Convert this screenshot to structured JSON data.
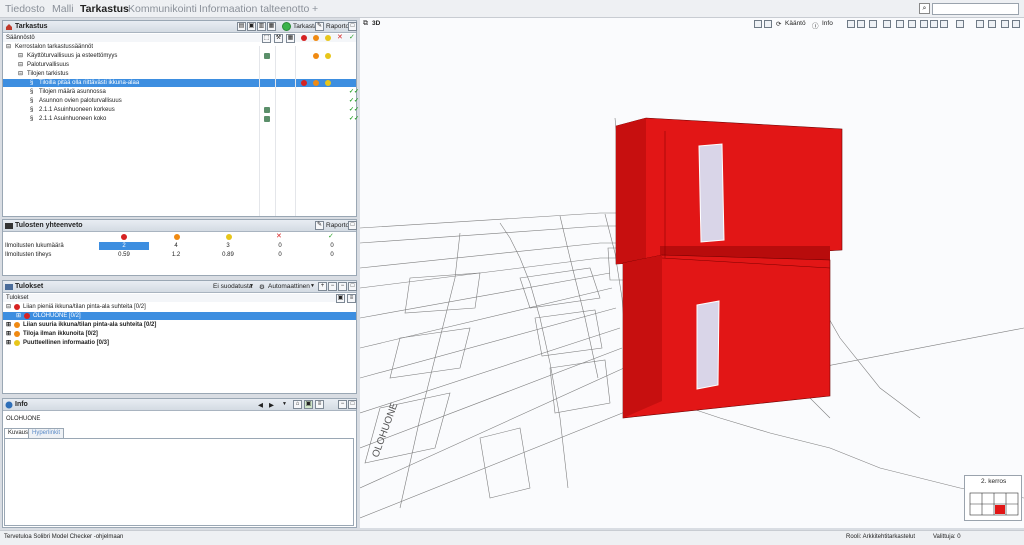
{
  "menu": {
    "items": [
      "Tiedosto",
      "Malli",
      "Tarkastus",
      "Kommunikointi",
      "Informaation talteenotto",
      "+"
    ],
    "active_index": 2
  },
  "tarkastus_panel": {
    "title": "Tarkastus",
    "subheader": "Säännöstö",
    "btn_check": "Tarkasta",
    "btn_report": "Raportoi",
    "tree": [
      {
        "label": "Kerrostalon tarkastussäännöt",
        "level": 0,
        "kind": "ruleset",
        "selected": false
      },
      {
        "label": "Käyttöturvallisuus ja esteettömyys",
        "level": 1,
        "kind": "ruleset",
        "selected": false
      },
      {
        "label": "Paloturvallisuus",
        "level": 1,
        "kind": "ruleset",
        "selected": false
      },
      {
        "label": "Tilojen tarkistus",
        "level": 1,
        "kind": "ruleset",
        "selected": false
      },
      {
        "label": "Tiloilla pitää olla riittävästi ikkuna-alaa",
        "level": 2,
        "kind": "rule",
        "selected": true
      },
      {
        "label": "Tilojen määrä asunnossa",
        "level": 2,
        "kind": "rule",
        "selected": false
      },
      {
        "label": "Asunnon ovien paloturvallisuus",
        "level": 2,
        "kind": "rule",
        "selected": false
      },
      {
        "label": "2.1.1 Asuinhuoneen korkeus",
        "level": 2,
        "kind": "rule",
        "selected": false
      },
      {
        "label": "2.1.1 Asuinhuoneen koko",
        "level": 2,
        "kind": "rule",
        "selected": false
      }
    ]
  },
  "summary_panel": {
    "title": "Tulosten yhteenveto",
    "btn_report": "Raportoi",
    "rows": [
      {
        "label": "Ilmoitusten lukumäärä",
        "values": [
          "2",
          "4",
          "3",
          "0",
          "0"
        ]
      },
      {
        "label": "Ilmoitusten tiheys",
        "values": [
          "0.59",
          "1.2",
          "0.89",
          "0",
          "0"
        ]
      }
    ]
  },
  "results_panel": {
    "title": "Tulokset",
    "filter_label": "Ei suodatusta",
    "auto_label": "Automaattinen",
    "subheader": "Tulokset",
    "items": [
      {
        "label": "Liian pieniä ikkuna/tilan pinta-ala suhteita [0/2]",
        "level": 0,
        "bold": false,
        "selected": false,
        "severity": "red"
      },
      {
        "label": "OLOHUONE [0/2]",
        "level": 1,
        "bold": false,
        "selected": true,
        "severity": "red"
      },
      {
        "label": "Liian suuria ikkuna/tilan pinta-ala suhteita [0/2]",
        "level": 0,
        "bold": true,
        "selected": false,
        "severity": "orange"
      },
      {
        "label": "Tiloja ilman ikkunoita [0/2]",
        "level": 0,
        "bold": true,
        "selected": false,
        "severity": "orange"
      },
      {
        "label": "Puutteellinen informaatio [0/3]",
        "level": 0,
        "bold": true,
        "selected": false,
        "severity": "yellow"
      }
    ]
  },
  "info_panel": {
    "title": "Info",
    "value": "OLOHUONE",
    "tabs": [
      "Kuvaus",
      "Hyperlinkit"
    ]
  },
  "view3d": {
    "title": "3D",
    "rotate_label": "Kääntö",
    "info_label": "Info",
    "floor_label": "2. kerros",
    "model_text": "OLOHUONE"
  },
  "statusbar": {
    "left": "Tervetuloa Solibri Model Checker -ohjelmaan",
    "role": "Rooli: Arkkitehtitarkastelut",
    "selection": "Valittuja: 0"
  },
  "colors": {
    "selection": "#3d8ee0",
    "error_red": "#e21616",
    "ok_green": "#2aa12a"
  }
}
